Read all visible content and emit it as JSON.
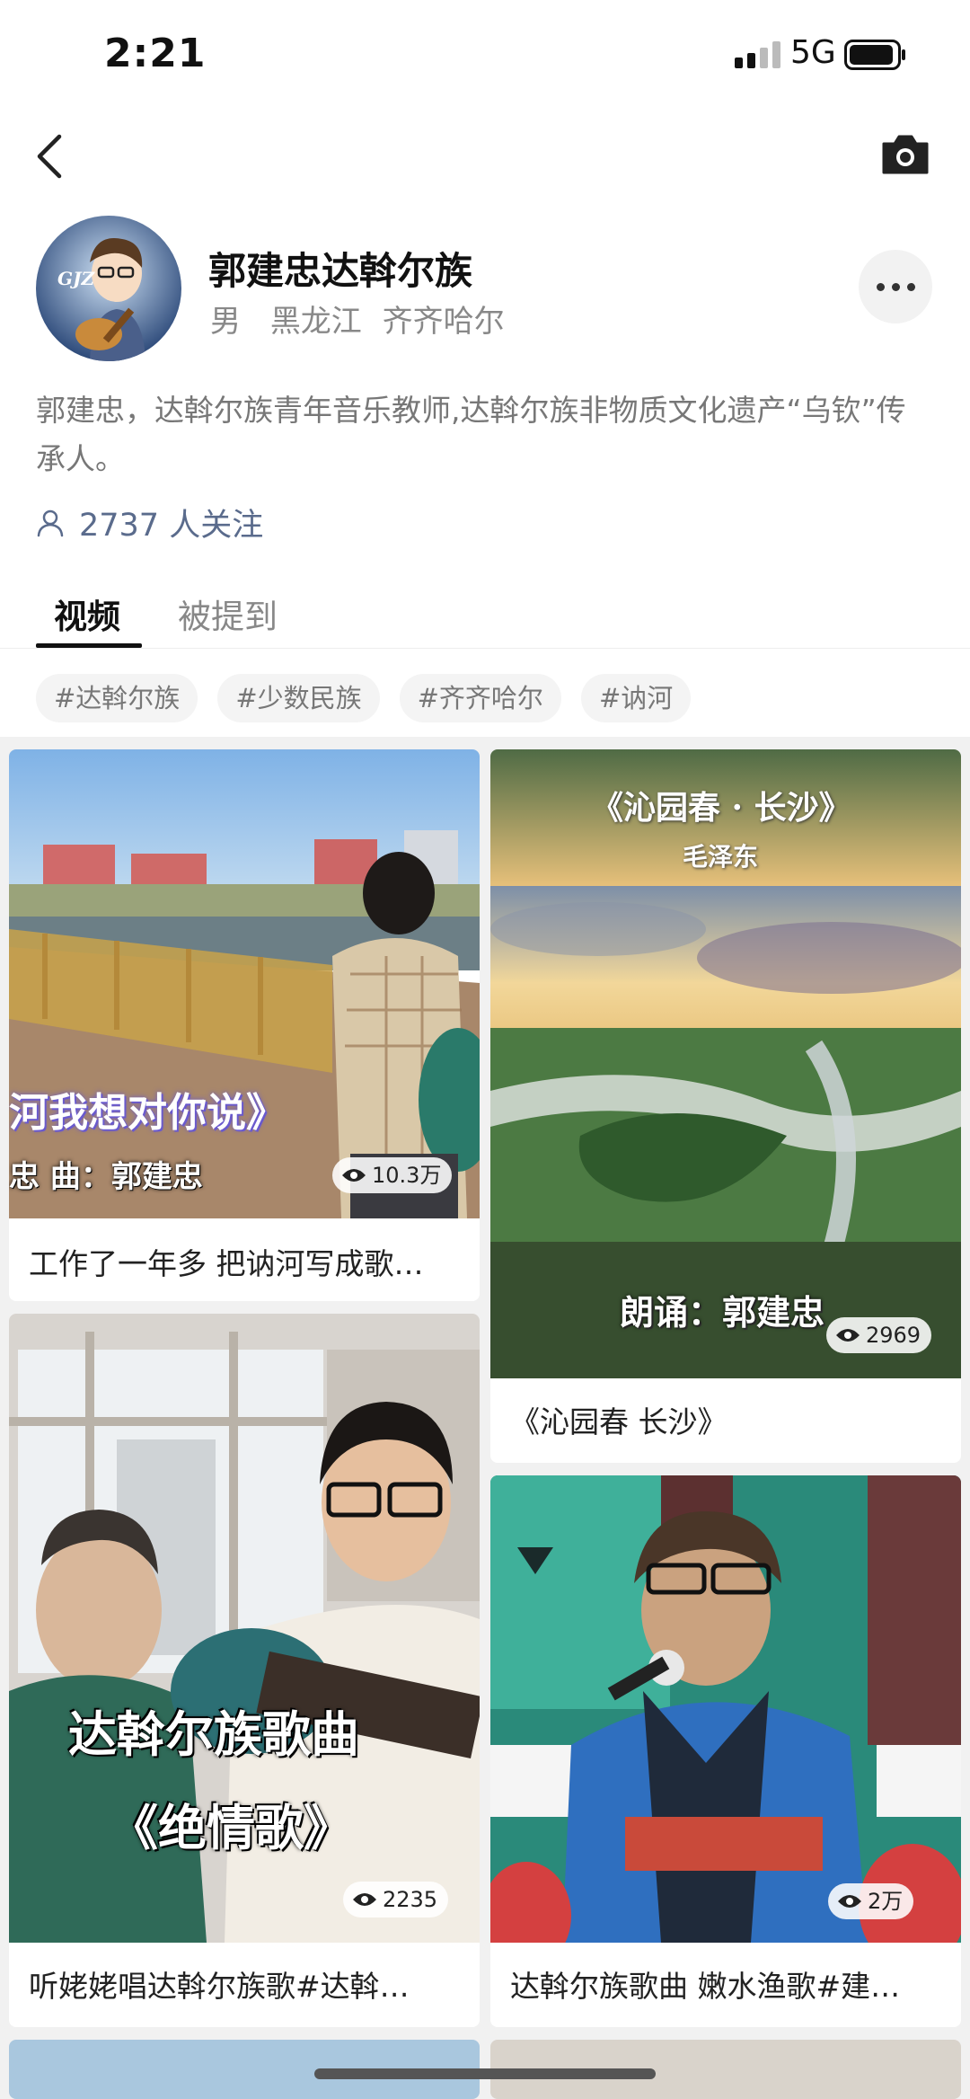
{
  "status_bar": {
    "time": "2:21",
    "network": "5G"
  },
  "profile": {
    "name": "郭建忠达斡尔族",
    "gender": "男",
    "province": "黑龙江",
    "city": "齐齐哈尔",
    "avatar_text": "GJZ",
    "bio": "郭建忠，达斡尔族青年音乐教师,达斡尔族非物质文化遗产“乌钦”传承人。",
    "followers": "2737 人关注"
  },
  "tabs": [
    {
      "label": "视频",
      "active": true
    },
    {
      "label": "被提到",
      "active": false
    }
  ],
  "tags": [
    "#达斡尔族",
    "#少数民族",
    "#齐齐哈尔",
    "#讷河"
  ],
  "videos": [
    {
      "caption": "工作了一年多 把讷河写成歌…",
      "views": "10.3万",
      "overlay_line1": "河我想对你说》",
      "overlay_line2": "忠 曲：郭建忠"
    },
    {
      "caption": "《沁园春 长沙》",
      "views": "2969",
      "overlay_title": "《沁园春 · 长沙》",
      "overlay_author": "毛泽东",
      "overlay_reader": "朗诵：郭建忠"
    },
    {
      "caption": "听姥姥唱达斡尔族歌#达斡…",
      "views": "2235",
      "overlay_line1": "达斡尔族歌曲",
      "overlay_line2": "《绝情歌》"
    },
    {
      "caption": "达斡尔族歌曲 嫩水渔歌#建…",
      "views": "2万"
    }
  ],
  "icons": {
    "back": "back-arrow-icon",
    "camera": "camera-icon",
    "more": "more-dots-icon",
    "follow": "person-icon",
    "views": "eye-icon"
  },
  "colors": {
    "accent_text": "#5a6b8c",
    "muted_text": "#888888",
    "tag_bg": "#f4f4f4",
    "feed_bg": "#f1f1f1"
  }
}
